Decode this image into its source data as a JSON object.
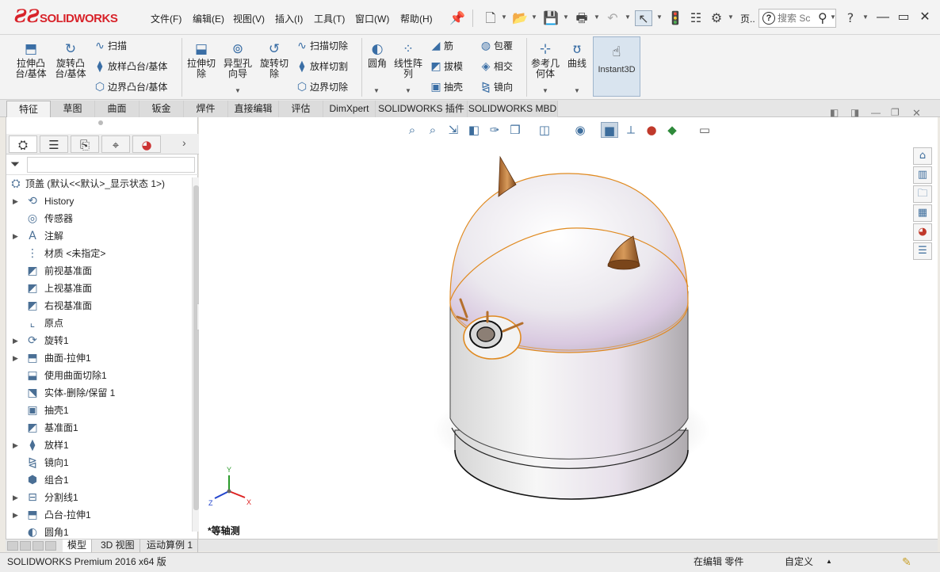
{
  "app": {
    "logo_text": "SOLIDWORKS",
    "status_text": "SOLIDWORKS Premium 2016 x64 版",
    "status_edit": "在编辑 零件",
    "status_custom": "自定义"
  },
  "menu": [
    "文件(F)",
    "编辑(E)",
    "视图(V)",
    "插入(I)",
    "工具(T)",
    "窗口(W)",
    "帮助(H)"
  ],
  "toolbar": {
    "page_label": "页..",
    "search_placeholder": "搜索 Sc",
    "help_label": "?"
  },
  "features": {
    "extrude_boss": "拉伸凸\n台/基体",
    "revolve_boss": "旋转凸\n台/基体",
    "sweep": "扫描",
    "loft_boss": "放样凸台/基体",
    "boundary_boss": "边界凸台/基体",
    "extrude_cut": "拉伸切\n除",
    "hole_wizard": "异型孔\n向导",
    "revolve_cut": "旋转切\n除",
    "sweep_cut": "扫描切除",
    "loft_cut": "放样切割",
    "boundary_cut": "边界切除",
    "fillet": "圆角",
    "linear_pattern": "线性阵\n列",
    "rib": "筋",
    "draft": "拔模",
    "shell": "抽壳",
    "wrap": "包覆",
    "intersect": "相交",
    "mirror": "镜向",
    "ref_geometry": "参考几\n何体",
    "curves": "曲线",
    "instant3d": "Instant3D"
  },
  "tabs": [
    "特征",
    "草图",
    "曲面",
    "钣金",
    "焊件",
    "直接编辑",
    "评估",
    "DimXpert",
    "SOLIDWORKS 插件",
    "SOLIDWORKS MBD"
  ],
  "tree": {
    "root": "顶盖 (默认<<默认>_显示状态 1>)",
    "items": [
      {
        "label": "History",
        "expand": true
      },
      {
        "label": "传感器",
        "expand": false
      },
      {
        "label": "注解",
        "expand": true
      },
      {
        "label": "材质 <未指定>",
        "expand": false
      },
      {
        "label": "前视基准面",
        "expand": false
      },
      {
        "label": "上视基准面",
        "expand": false
      },
      {
        "label": "右视基准面",
        "expand": false
      },
      {
        "label": "原点",
        "expand": false
      },
      {
        "label": "旋转1",
        "expand": true
      },
      {
        "label": "曲面-拉伸1",
        "expand": true
      },
      {
        "label": "使用曲面切除1",
        "expand": false
      },
      {
        "label": "实体-删除/保留 1",
        "expand": false
      },
      {
        "label": "抽壳1",
        "expand": false
      },
      {
        "label": "基准面1",
        "expand": false
      },
      {
        "label": "放样1",
        "expand": true
      },
      {
        "label": "镜向1",
        "expand": false
      },
      {
        "label": "组合1",
        "expand": false
      },
      {
        "label": "分割线1",
        "expand": true
      },
      {
        "label": "凸台-拉伸1",
        "expand": true
      },
      {
        "label": "圆角1",
        "expand": false
      }
    ]
  },
  "bottom_tabs": [
    "模型",
    "3D 视图",
    "运动算例 1"
  ],
  "viewport": {
    "view_name": "*等轴测",
    "axis_x": "X",
    "axis_y": "Y",
    "axis_z": "Z"
  }
}
